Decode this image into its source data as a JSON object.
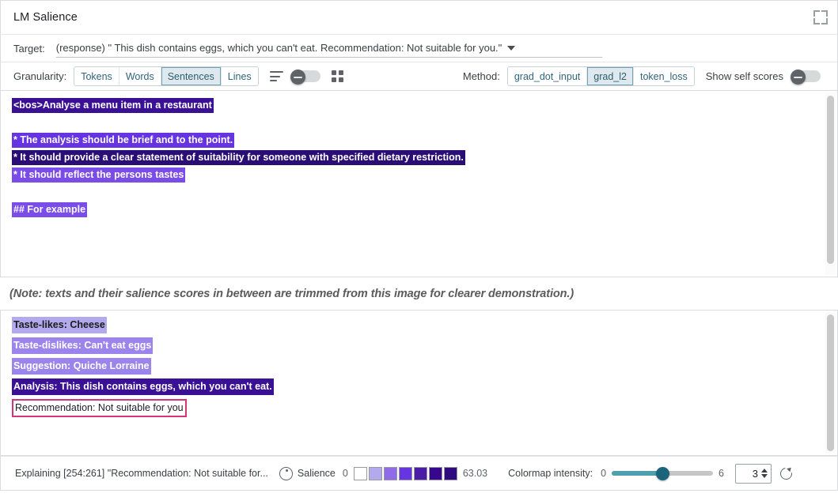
{
  "window": {
    "title": "LM Salience",
    "expand_icon": "fullscreen-expand-icon"
  },
  "target": {
    "label": "Target:",
    "value": "(response) \" This dish contains eggs, which you can't eat. Recommendation: Not suitable for you.\"",
    "caret_icon": "chevron-down-icon"
  },
  "controls": {
    "granularity_label": "Granularity:",
    "granularity_options": [
      "Tokens",
      "Words",
      "Sentences",
      "Lines"
    ],
    "granularity_selected": "Sentences",
    "lines_icon": "text-lines-icon",
    "display_toggle_state": "off",
    "grid_icon": "grid-view-icon",
    "method_label": "Method:",
    "method_options": [
      "grad_dot_input",
      "grad_l2",
      "token_loss"
    ],
    "method_selected": "grad_l2",
    "self_scores_label": "Show self scores",
    "self_scores_state": "off"
  },
  "prompt_panel": {
    "segments": [
      {
        "text": "<bos>Analyse a menu item in a restaurant",
        "color": "#3a1194",
        "fg": "#ffffff"
      },
      {
        "text": "",
        "color": "#c8c0f2",
        "fg": "#000000"
      },
      {
        "text": "* The analysis should be brief and to the point.",
        "color": "#6634e0",
        "fg": "#ffffff"
      },
      {
        "text": "* It should provide a clear statement of suitability for someone with specified dietary restriction.",
        "color": "#2a0e75",
        "fg": "#ffffff"
      },
      {
        "text": "* It should reflect the persons tastes",
        "color": "#7a4ce8",
        "fg": "#ffffff"
      },
      {
        "text": "",
        "color": "#c0b6f0",
        "fg": "#000000"
      },
      {
        "text": "## For example",
        "color": "#7a4ce8",
        "fg": "#ffffff"
      },
      {
        "text": "",
        "color": "#c0b6f0",
        "fg": "#000000"
      }
    ]
  },
  "note": {
    "text": "(Note: texts and their salience scores in between are trimmed from this image for clearer demonstration.)"
  },
  "response_panel": {
    "segments": [
      {
        "text": "Taste-likes: Cheese",
        "color": "#b3aaee",
        "fg": "#1a1a1a",
        "outlined": false
      },
      {
        "text": "Taste-dislikes: Can't eat eggs",
        "color": "#9b84ec",
        "fg": "#ffffff",
        "outlined": false
      },
      {
        "text": "Suggestion: Quiche Lorraine",
        "color": "#9b84ec",
        "fg": "#ffffff",
        "outlined": false
      },
      {
        "text": "Analysis: This dish contains eggs, which you can't eat.",
        "color": "#3a1194",
        "fg": "#ffffff",
        "outlined": false
      },
      {
        "text": "Recommendation: Not suitable for you",
        "color": "#ffffff",
        "fg": "#202124",
        "outlined": true,
        "outline_color": "#d6337a"
      }
    ]
  },
  "statusbar": {
    "explaining_text": "Explaining [254:261] \"Recommendation: Not suitable for...",
    "palette_icon": "color-palette-icon",
    "salience_label": "Salience",
    "legend_min": "0",
    "legend_max": "63.03",
    "legend_swatches": [
      "#ffffff",
      "#b3aaee",
      "#8f6bea",
      "#6634e0",
      "#4a1aa8",
      "#37088f",
      "#2e0b7e"
    ],
    "intensity_label": "Colormap intensity:",
    "slider_min": "0",
    "slider_max": "6",
    "slider_value": 3,
    "stepper_value": "3",
    "spinner_icon": "spinner-updown-icon",
    "reset_icon": "reset-circular-arrow-icon"
  }
}
